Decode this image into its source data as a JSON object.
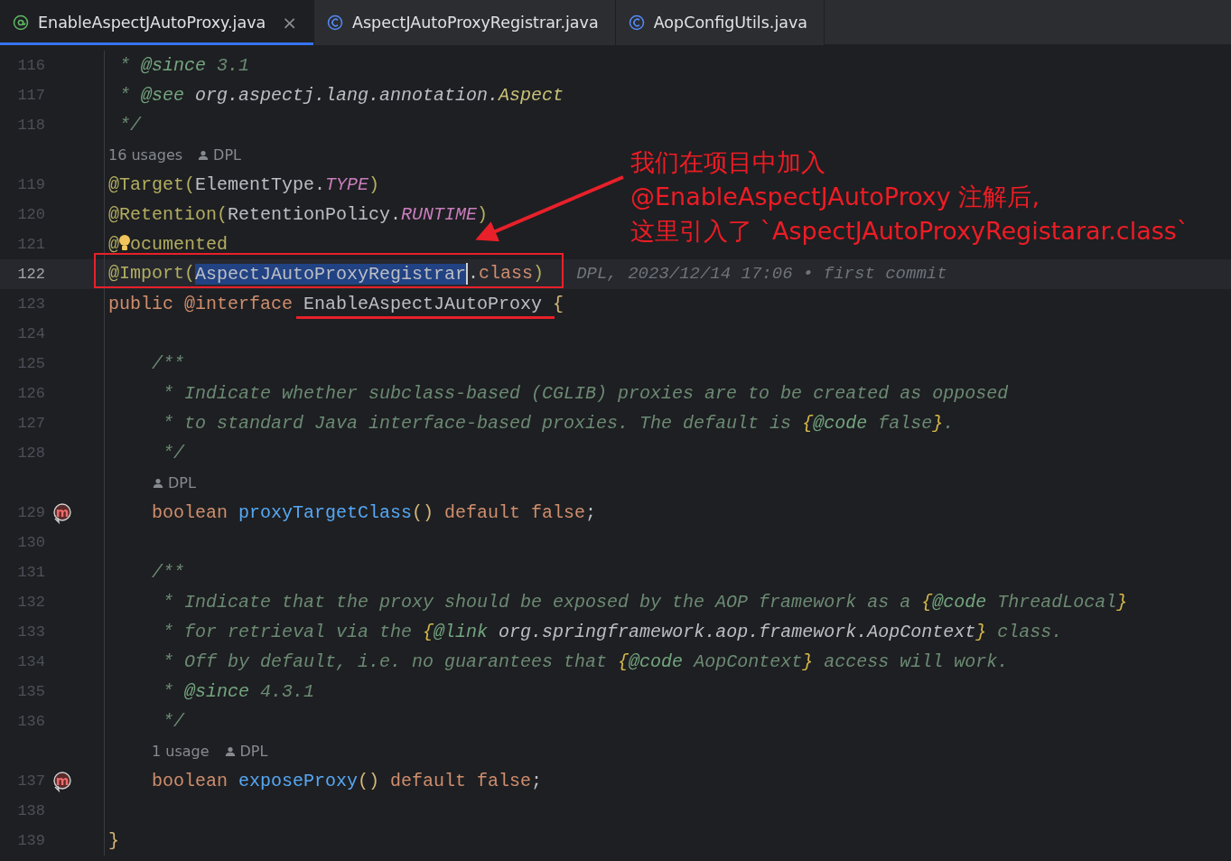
{
  "tabs": [
    {
      "label": "EnableAspectJAutoProxy.java",
      "kind": "annotation",
      "selected": true,
      "close": "×"
    },
    {
      "label": "AspectJAutoProxyRegistrar.java",
      "kind": "class",
      "selected": false
    },
    {
      "label": "AopConfigUtils.java",
      "kind": "class",
      "selected": false
    }
  ],
  "editor": {
    "lines": [
      {
        "kind": "code",
        "number": "116",
        "current": false,
        "tokens": [
          {
            "t": " * ",
            "kind": "comment"
          },
          {
            "t": "@since",
            "kind": "doc-tag"
          },
          {
            "t": " 3.1",
            "kind": "comment"
          }
        ]
      },
      {
        "kind": "code",
        "number": "117",
        "current": false,
        "tokens": [
          {
            "t": " * ",
            "kind": "comment"
          },
          {
            "t": "@see",
            "kind": "doc-tag"
          },
          {
            "t": " org.aspectj.lang.annotation.",
            "kind": "doc-ref"
          },
          {
            "t": "Aspect",
            "kind": "doc-type"
          }
        ]
      },
      {
        "kind": "code",
        "number": "118",
        "current": false,
        "tokens": [
          {
            "t": " */",
            "kind": "comment"
          }
        ]
      },
      {
        "kind": "hint",
        "usages": "16 usages",
        "author": "DPL"
      },
      {
        "kind": "code",
        "number": "119",
        "current": false,
        "tokens": [
          {
            "t": "@Target(",
            "kind": "annotation"
          },
          {
            "t": "ElementType.",
            "kind": "plain"
          },
          {
            "t": "TYPE",
            "kind": "constant"
          },
          {
            "t": ")",
            "kind": "annotation"
          }
        ]
      },
      {
        "kind": "code",
        "number": "120",
        "current": false,
        "tokens": [
          {
            "t": "@Retention(",
            "kind": "annotation"
          },
          {
            "t": "RetentionPolicy.",
            "kind": "plain"
          },
          {
            "t": "RUNTIME",
            "kind": "constant"
          },
          {
            "t": ")",
            "kind": "annotation"
          }
        ]
      },
      {
        "kind": "code",
        "number": "121",
        "current": false,
        "bulb": true,
        "tokens": [
          {
            "t": "@",
            "kind": "annotation"
          },
          {
            "t": "ocumented",
            "kind": "annotation"
          }
        ]
      },
      {
        "kind": "code",
        "number": "122",
        "current": true,
        "blame": "DPL, 2023/12/14 17:06 • first commit",
        "tokens": [
          {
            "t": "@Import(",
            "kind": "annotation"
          },
          {
            "t": "AspectJAutoProxyRegistrar",
            "kind": "selected-text"
          },
          {
            "t": ".",
            "kind": "plain"
          },
          {
            "t": "class",
            "kind": "keyword"
          },
          {
            "t": ")",
            "kind": "annotation"
          }
        ]
      },
      {
        "kind": "code",
        "number": "123",
        "current": false,
        "tokens": [
          {
            "t": "public ",
            "kind": "keyword"
          },
          {
            "t": "@interface ",
            "kind": "keyword"
          },
          {
            "t": "EnableAspectJAutoProxy",
            "kind": "plain"
          },
          {
            "t": " {",
            "kind": "brace"
          }
        ]
      },
      {
        "kind": "code",
        "number": "124",
        "current": false
      },
      {
        "kind": "code",
        "number": "125",
        "current": false,
        "tokens": [
          {
            "t": "    /**",
            "kind": "comment"
          }
        ]
      },
      {
        "kind": "code",
        "number": "126",
        "current": false,
        "tokens": [
          {
            "t": "     * Indicate whether subclass-based (CGLIB) proxies are to be created as opposed",
            "kind": "comment"
          }
        ]
      },
      {
        "kind": "code",
        "number": "127",
        "current": false,
        "tokens": [
          {
            "t": "     * to standard Java interface-based proxies. The default is ",
            "kind": "comment"
          },
          {
            "t": "{",
            "kind": "doc-brace"
          },
          {
            "t": "@code",
            "kind": "doc-tag"
          },
          {
            "t": " false",
            "kind": "comment"
          },
          {
            "t": "}",
            "kind": "doc-brace"
          },
          {
            "t": ".",
            "kind": "comment"
          }
        ]
      },
      {
        "kind": "code",
        "number": "128",
        "current": false,
        "tokens": [
          {
            "t": "     */",
            "kind": "comment"
          }
        ]
      },
      {
        "kind": "hint",
        "author": "DPL"
      },
      {
        "kind": "code",
        "number": "129",
        "current": false,
        "marker": "m",
        "tokens": [
          {
            "t": "    boolean ",
            "kind": "keyword"
          },
          {
            "t": "proxyTargetClass",
            "kind": "method"
          },
          {
            "t": "()",
            "kind": "brace"
          },
          {
            "t": " default false",
            "kind": "keyword"
          },
          {
            "t": ";",
            "kind": "plain"
          }
        ]
      },
      {
        "kind": "code",
        "number": "130",
        "current": false
      },
      {
        "kind": "code",
        "number": "131",
        "current": false,
        "tokens": [
          {
            "t": "    /**",
            "kind": "comment"
          }
        ]
      },
      {
        "kind": "code",
        "number": "132",
        "current": false,
        "tokens": [
          {
            "t": "     * Indicate that the proxy should be exposed by the AOP framework as a ",
            "kind": "comment"
          },
          {
            "t": "{",
            "kind": "doc-brace"
          },
          {
            "t": "@code",
            "kind": "doc-tag"
          },
          {
            "t": " ThreadLocal",
            "kind": "comment"
          },
          {
            "t": "}",
            "kind": "doc-brace"
          }
        ]
      },
      {
        "kind": "code",
        "number": "133",
        "current": false,
        "tokens": [
          {
            "t": "     * for retrieval via the ",
            "kind": "comment"
          },
          {
            "t": "{",
            "kind": "doc-brace"
          },
          {
            "t": "@link",
            "kind": "doc-tag"
          },
          {
            "t": " org.springframework.aop.framework.AopContext",
            "kind": "doc-ref"
          },
          {
            "t": "}",
            "kind": "doc-brace"
          },
          {
            "t": " class.",
            "kind": "comment"
          }
        ]
      },
      {
        "kind": "code",
        "number": "134",
        "current": false,
        "tokens": [
          {
            "t": "     * Off by default, i.e. no guarantees that ",
            "kind": "comment"
          },
          {
            "t": "{",
            "kind": "doc-brace"
          },
          {
            "t": "@code",
            "kind": "doc-tag"
          },
          {
            "t": " AopContext",
            "kind": "comment"
          },
          {
            "t": "}",
            "kind": "doc-brace"
          },
          {
            "t": " access will work.",
            "kind": "comment"
          }
        ]
      },
      {
        "kind": "code",
        "number": "135",
        "current": false,
        "tokens": [
          {
            "t": "     * ",
            "kind": "comment"
          },
          {
            "t": "@since",
            "kind": "doc-tag"
          },
          {
            "t": " 4.3.1",
            "kind": "comment"
          }
        ]
      },
      {
        "kind": "code",
        "number": "136",
        "current": false,
        "tokens": [
          {
            "t": "     */",
            "kind": "comment"
          }
        ]
      },
      {
        "kind": "hint",
        "usages": "1 usage",
        "author": "DPL"
      },
      {
        "kind": "code",
        "number": "137",
        "current": false,
        "marker": "m",
        "tokens": [
          {
            "t": "    boolean ",
            "kind": "keyword"
          },
          {
            "t": "exposeProxy",
            "kind": "method"
          },
          {
            "t": "()",
            "kind": "brace"
          },
          {
            "t": " default false",
            "kind": "keyword"
          },
          {
            "t": ";",
            "kind": "plain"
          }
        ]
      },
      {
        "kind": "code",
        "number": "138",
        "current": false
      },
      {
        "kind": "code",
        "number": "139",
        "current": false,
        "tokens": [
          {
            "t": "}",
            "kind": "brace"
          }
        ]
      }
    ]
  },
  "callout": {
    "lines": [
      "我们在项目中加入",
      "@EnableAspectJAutoProxy 注解后,",
      "这里引入了 `AspectJAutoProxyRegistarar.class`"
    ]
  }
}
